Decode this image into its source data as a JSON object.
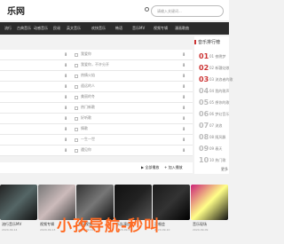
{
  "header": {
    "logo": "乐网",
    "search_placeholder": "请输入关键词..."
  },
  "nav": [
    "流行",
    "古典音乐",
    "动感音乐",
    "民谣",
    "英文音乐",
    "欢快音乐",
    "韩语",
    "音乐MV",
    "视频专辑",
    "漫画歌曲"
  ],
  "songs": [
    "我爱你",
    "我爱你，不许分开",
    "热情火焰",
    "遥远的人",
    "美丽的冬",
    "热门新歌",
    "好听歌",
    "情歌",
    "一生一世",
    "遇见你"
  ],
  "actions": {
    "play_all": "全部播放",
    "add_to_list": "加入播放"
  },
  "ranking": {
    "title": "音乐排行榜",
    "items": [
      "01 夜晚梦",
      "02 新疆姑娘",
      "03 流浪者的歌",
      "04 我的歌声",
      "05 想你的歌",
      "06 梦幻音乐",
      "07 流浪",
      "08 随风飘",
      "09 春天",
      "10 热门歌"
    ]
  },
  "more": "更多",
  "videos": [
    {
      "title": "流行音乐MV",
      "date": "2020-09-14"
    },
    {
      "title": "视频专辑",
      "date": "2020-09-13"
    },
    {
      "title": "音乐视频",
      "date": "2020-09-12"
    },
    {
      "title": "乐队演出",
      "date": "2020-09-11"
    },
    {
      "title": "演唱会",
      "date": "2020-09-10"
    },
    {
      "title": "音乐现场",
      "date": "2020-09-09"
    }
  ],
  "watermark": "小孜导航-秒叫"
}
